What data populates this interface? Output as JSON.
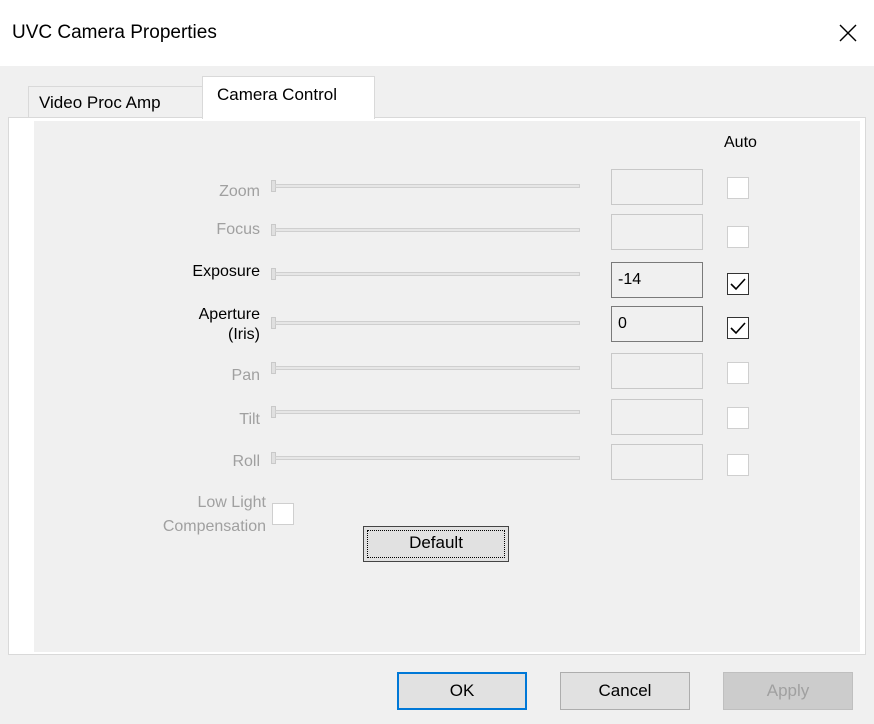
{
  "window": {
    "title": "UVC Camera Properties"
  },
  "tabs": [
    {
      "label": "Video Proc Amp",
      "active": false
    },
    {
      "label": "Camera Control",
      "active": true
    }
  ],
  "auto_header": "Auto",
  "properties": [
    {
      "label": "Zoom",
      "value": "",
      "enabled": false,
      "auto": false
    },
    {
      "label": "Focus",
      "value": "",
      "enabled": false,
      "auto": false
    },
    {
      "label": "Exposure",
      "value": "-14",
      "enabled": true,
      "auto": true
    },
    {
      "label_line1": "Aperture",
      "label_line2": "(Iris)",
      "value": "0",
      "enabled": true,
      "auto": true
    },
    {
      "label": "Pan",
      "value": "",
      "enabled": false,
      "auto": false
    },
    {
      "label": "Tilt",
      "value": "",
      "enabled": false,
      "auto": false
    },
    {
      "label": "Roll",
      "value": "",
      "enabled": false,
      "auto": false
    }
  ],
  "low_light": {
    "line1": "Low Light",
    "line2": "Compensation",
    "checked": false,
    "enabled": false
  },
  "default_button": "Default",
  "footer": {
    "ok": "OK",
    "cancel": "Cancel",
    "apply": "Apply"
  },
  "colors": {
    "disabled_text": "#a0a0a0",
    "focus_blue": "#0078d7"
  },
  "icons": {
    "close": "close-icon",
    "check": "checkmark-icon"
  }
}
